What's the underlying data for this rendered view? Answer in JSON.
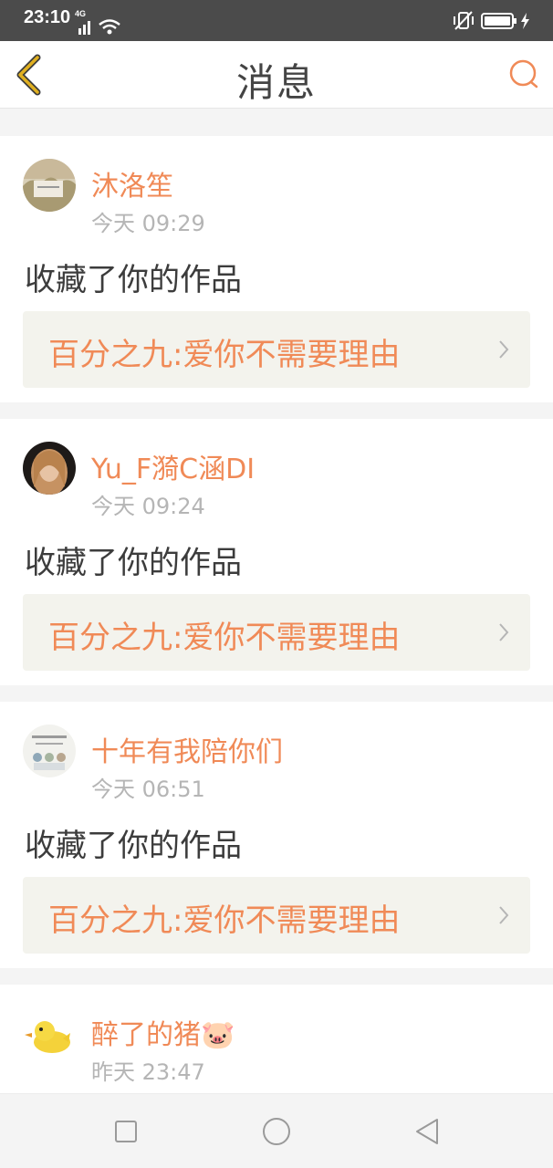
{
  "status_bar": {
    "time": "23:10",
    "network": "4G",
    "icons": [
      "signal-icon",
      "wifi-icon",
      "vibrate-icon",
      "battery-icon",
      "charging-icon"
    ]
  },
  "header": {
    "title": "消息",
    "back_icon": "chevron-left-icon",
    "search_icon": "search-icon"
  },
  "colors": {
    "accent": "#f08a57",
    "back_icon": "#e0b020",
    "text_primary": "#3c3c3c",
    "text_muted": "#b5b5b5",
    "link_bg": "#f3f3ed",
    "status_bar": "#4b4b4b"
  },
  "messages": [
    {
      "username": "沐洛笙",
      "time": "今天 09:29",
      "action": "收藏了你的作品",
      "work_title": "百分之九:爱你不需要理由"
    },
    {
      "username": "Yu_F漪C涵DI",
      "time": "今天 09:24",
      "action": "收藏了你的作品",
      "work_title": "百分之九:爱你不需要理由"
    },
    {
      "username": "十年有我陪你们",
      "time": "今天 06:51",
      "action": "收藏了你的作品",
      "work_title": "百分之九:爱你不需要理由"
    },
    {
      "username": "醉了的猪🐷",
      "time": "昨天 23:47"
    }
  ],
  "system_nav": {
    "icons": [
      "recent-apps-icon",
      "home-icon",
      "back-icon"
    ]
  }
}
